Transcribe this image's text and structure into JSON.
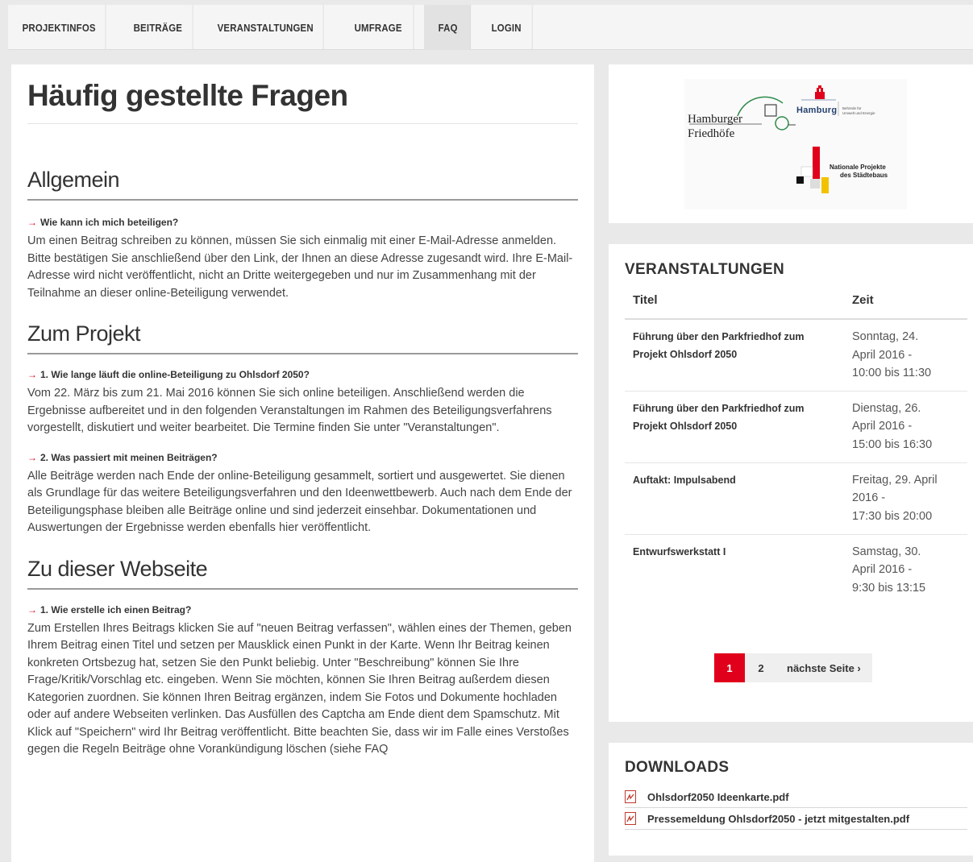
{
  "nav": [
    {
      "label": "PROJEKTINFOS",
      "active": false
    },
    {
      "label": "BEITRÄGE",
      "active": false
    },
    {
      "label": "VERANSTALTUNGEN",
      "active": false
    },
    {
      "label": "UMFRAGE",
      "active": false
    },
    {
      "label": "FAQ",
      "active": true
    },
    {
      "label": "LOGIN",
      "active": false
    }
  ],
  "main": {
    "title": "Häufig gestellte Fragen",
    "sections": [
      {
        "heading": "Allgemein",
        "questions": [
          {
            "q": "Wie kann ich mich beteiligen?",
            "a": "Um einen Beitrag schreiben zu können, müssen Sie sich einmalig mit einer E-Mail-Adresse anmelden. Bitte bestätigen Sie anschließend über den Link, der Ihnen an diese Adresse zugesandt wird. Ihre E-Mail-Adresse wird nicht veröffentlicht, nicht an Dritte weitergegeben und nur im Zusammenhang mit der Teilnahme an dieser online-Beteiligung verwendet."
          }
        ]
      },
      {
        "heading": "Zum Projekt",
        "questions": [
          {
            "q": "1. Wie lange läuft die online-Beteiligung zu Ohlsdorf 2050?",
            "a": "Vom 22. März bis zum 21. Mai 2016 können Sie sich online beteiligen. Anschließend werden die Ergebnisse aufbereitet und in den folgenden Veranstaltungen im Rahmen des Beteiligungsverfahrens vorgestellt, diskutiert und weiter bearbeitet. Die Termine finden Sie unter \"Veranstaltungen\"."
          },
          {
            "q": "2. Was passiert mit meinen Beiträgen?",
            "a": "Alle Beiträge werden nach Ende der online-Beteiligung gesammelt, sortiert und ausgewertet. Sie dienen als Grundlage für das weitere Beteiligungsverfahren und den Ideenwettbewerb. Auch nach dem Ende der Beteiligungsphase bleiben alle Beiträge online und sind jederzeit einsehbar. Dokumentationen und Auswertungen der Ergebnisse werden ebenfalls hier veröffentlicht."
          }
        ]
      },
      {
        "heading": "Zu dieser Webseite",
        "questions": [
          {
            "q": "1. Wie erstelle ich einen Beitrag?",
            "a": "Zum Erstellen Ihres Beitrags klicken Sie auf \"neuen Beitrag verfassen\", wählen eines der Themen, geben Ihrem Beitrag einen Titel und setzen per Mausklick einen Punkt in der Karte. Wenn Ihr Beitrag keinen konkreten Ortsbezug hat, setzen Sie den Punkt beliebig. Unter \"Beschreibung\" können Sie Ihre Frage/Kritik/Vorschlag etc. eingeben. Wenn Sie möchten, können Sie Ihren Beitrag außerdem diesen Kategorien zuordnen. Sie können Ihren Beitrag ergänzen, indem Sie Fotos und Dokumente hochladen oder auf andere Webseiten verlinken. Das Ausfüllen des Captcha am Ende dient dem Spamschutz. Mit Klick auf \"Speichern\" wird Ihr Beitrag veröffentlicht. Bitte beachten Sie, dass wir im Falle eines Verstoßes gegen die Regeln Beiträge ohne Vorankündigung löschen (siehe FAQ"
          }
        ]
      }
    ]
  },
  "logos": {
    "friedhoefe_line1": "Hamburger",
    "friedhoefe_line2": "Friedhöfe",
    "hamburg": "Hamburg",
    "behoerde_line1": "Behörde für",
    "behoerde_line2": "Umwelt und Energie",
    "nationale_line1": "Nationale Projekte",
    "nationale_line2": "des Städtebaus"
  },
  "events": {
    "title": "VERANSTALTUNGEN",
    "col_title": "Titel",
    "col_time": "Zeit",
    "rows": [
      {
        "title": "Führung über den Parkfriedhof zum Projekt Ohlsdorf 2050",
        "time_l1": "Sonntag, 24.",
        "time_l2": "April 2016 -",
        "time_l3": "10:00 bis 11:30"
      },
      {
        "title": "Führung über den Parkfriedhof zum Projekt Ohlsdorf 2050",
        "time_l1": "Dienstag, 26.",
        "time_l2": "April 2016 -",
        "time_l3": "15:00 bis 16:30"
      },
      {
        "title": "Auftakt: Impulsabend",
        "time_l1": "Freitag, 29. April",
        "time_l2": "2016 -",
        "time_l3": "17:30 bis 20:00"
      },
      {
        "title": "Entwurfswerkstatt I",
        "time_l1": "Samstag, 30.",
        "time_l2": "April 2016 -",
        "time_l3": "9:30 bis 13:15"
      }
    ],
    "pager": {
      "current": "1",
      "page2": "2",
      "next": "nächste Seite ›"
    }
  },
  "downloads": {
    "title": "DOWNLOADS",
    "items": [
      {
        "label": "Ohlsdorf2050 Ideenkarte.pdf",
        "icon": "pdf-icon"
      },
      {
        "label": "Pressemeldung Ohlsdorf2050 - jetzt mitgestalten.pdf",
        "icon": "pdf-icon"
      }
    ]
  },
  "colors": {
    "accent": "#e0001b",
    "nav_bg": "#f5f5f5",
    "page_bg": "#e9e9e9"
  }
}
